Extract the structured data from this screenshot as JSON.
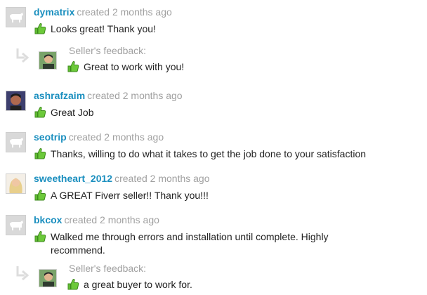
{
  "reviews": [
    {
      "user": "dymatrix",
      "time": "created 2 months ago",
      "text": "Looks great! Thank you!",
      "avatar": "cow-avatar"
    },
    {
      "user": "ashrafzaim",
      "time": "created 2 months ago",
      "text": "Great Job",
      "avatar": "photo-avatar"
    },
    {
      "user": "seotrip",
      "time": "created 2 months ago",
      "text": "Thanks, willing to do what it takes to get the job done to your satisfaction",
      "avatar": "cow-avatar"
    },
    {
      "user": "sweetheart_2012",
      "time": "created 2 months ago",
      "text": "A GREAT Fiverr seller!! Thank you!!!",
      "avatar": "photo-avatar"
    },
    {
      "user": "bkcox",
      "time": "created 2 months ago",
      "text": "Walked me through errors and installation until complete. Highly recommend.",
      "avatar": "cow-avatar"
    }
  ],
  "seller_feedback": [
    {
      "label": "Seller's feedback:",
      "text": "Great to work with you!"
    },
    {
      "label": "Seller's feedback:",
      "text": "a great buyer to work for."
    }
  ],
  "colors": {
    "username": "#1b8fbf",
    "meta": "#a0a0a0",
    "thumb": "#5cb82e"
  },
  "icons": {
    "thumb": "thumbs-up-icon",
    "reply": "reply-arrow-icon"
  }
}
